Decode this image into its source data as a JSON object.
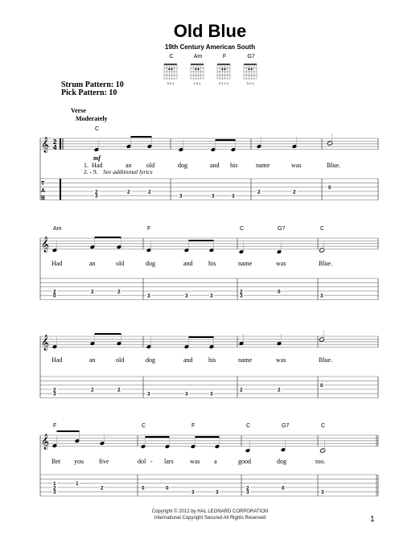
{
  "header": {
    "title": "Old Blue",
    "subtitle": "19th Century American South"
  },
  "chord_diagrams": [
    {
      "name": "C",
      "fingering": "3 2 1"
    },
    {
      "name": "Am",
      "fingering": "2 3 1"
    },
    {
      "name": "F",
      "fingering": "3 2 1 1"
    },
    {
      "name": "G7",
      "fingering": "3 2 1"
    }
  ],
  "patterns": {
    "strum": "Strum Pattern: 10",
    "pick": "Pick Pattern: 10"
  },
  "section": {
    "label": "Verse",
    "tempo": "Moderately",
    "dynamic": "mf",
    "time_signature": "2/4"
  },
  "systems": [
    {
      "chords": [
        {
          "label": "C",
          "at": 0
        }
      ],
      "verse_numbers": [
        "1.",
        "2. - 9."
      ],
      "lyrics": [
        "Had",
        "an",
        "old",
        "dog",
        "and",
        "his",
        "name",
        "was",
        "Blue."
      ],
      "lyrics_line2": "See additional lyrics",
      "tab": [
        {
          "s2": "2",
          "s3": "3"
        },
        {
          "s2": "2"
        },
        {
          "s2": "2"
        },
        {
          "s3": "3"
        },
        {
          "s3": "3"
        },
        {
          "s3": "3"
        },
        {
          "s2": "2"
        },
        {
          "s2": "2"
        },
        {
          "s1": "0"
        }
      ]
    },
    {
      "chords": [
        {
          "label": "Am",
          "at": 0
        },
        {
          "label": "F",
          "at": 3
        },
        {
          "label": "C",
          "at": 6
        },
        {
          "label": "G7",
          "at": 7
        },
        {
          "label": "C",
          "at": 8
        }
      ],
      "lyrics": [
        "Had",
        "an",
        "old",
        "dog",
        "and",
        "his",
        "name",
        "was",
        "Blue."
      ],
      "tab": [
        {
          "s2": "2",
          "s3": "0"
        },
        {
          "s2": "2"
        },
        {
          "s2": "2"
        },
        {
          "s3": "3"
        },
        {
          "s3": "3"
        },
        {
          "s3": "3"
        },
        {
          "s2": "2",
          "s3": "3"
        },
        {
          "s2": "0"
        },
        {
          "s3": "3"
        }
      ]
    },
    {
      "chords": [],
      "lyrics": [
        "Had",
        "an",
        "old",
        "dog",
        "and",
        "his",
        "name",
        "was",
        "Blue."
      ],
      "tab": [
        {
          "s2": "2",
          "s3": "3"
        },
        {
          "s2": "2"
        },
        {
          "s2": "2"
        },
        {
          "s3": "3"
        },
        {
          "s3": "3"
        },
        {
          "s3": "3"
        },
        {
          "s2": "2"
        },
        {
          "s2": "2"
        },
        {
          "s1": "0"
        }
      ]
    },
    {
      "chords": [
        {
          "label": "F",
          "at": 0
        },
        {
          "label": "C",
          "at": 3
        },
        {
          "label": "F",
          "at": 5
        },
        {
          "label": "C",
          "at": 7
        },
        {
          "label": "G7",
          "at": 8
        },
        {
          "label": "C",
          "at": 9
        }
      ],
      "lyrics": [
        "Bet",
        "you",
        "five",
        "dol",
        "-",
        "lars",
        "was",
        "a",
        "good",
        "dog",
        "too."
      ],
      "tab": [
        {
          "s1": "1",
          "s2": "2",
          "s3": "3"
        },
        {
          "s1": "1"
        },
        {
          "s2": "2"
        },
        {
          "s2": "0"
        },
        {
          "s2": "0"
        },
        {
          "s3": "3"
        },
        {
          "s3": "3"
        },
        {
          "s2": "2",
          "s3": "3"
        },
        {
          "s2": "0"
        },
        {
          "s3": "3"
        }
      ]
    }
  ],
  "footer": {
    "copyright": "Copyright © 2012 by HAL LEONARD CORPORATION",
    "rights": "International Copyright Secured    All Rights Reserved",
    "page_number": "1"
  }
}
